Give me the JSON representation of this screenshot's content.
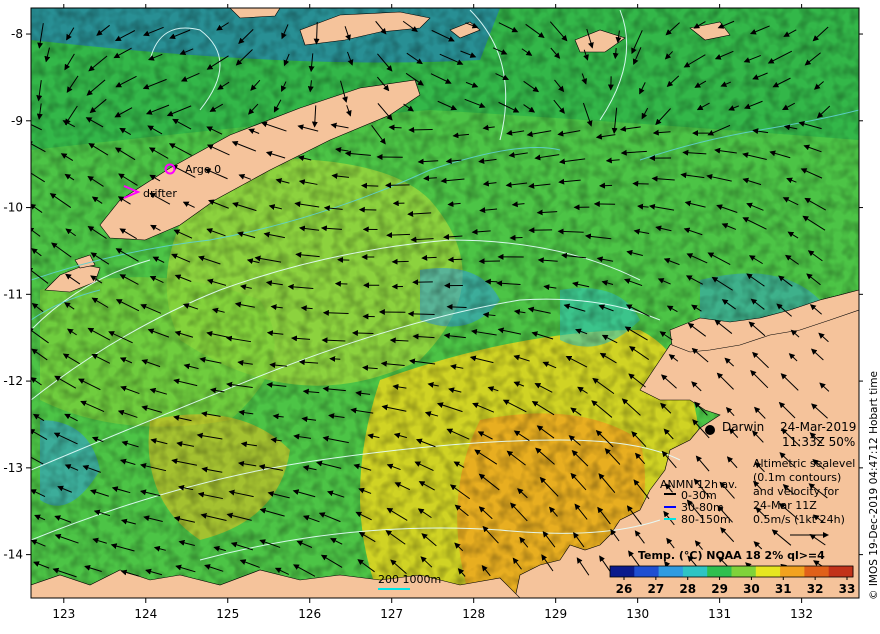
{
  "map": {
    "lon_ticks": [
      "123",
      "124",
      "125",
      "126",
      "127",
      "128",
      "129",
      "130",
      "131",
      "132"
    ],
    "lat_ticks": [
      "-8",
      "-9",
      "-10",
      "-11",
      "-12",
      "-13",
      "-14"
    ],
    "lon_range": [
      122.6,
      132.7
    ],
    "lat_range": [
      -7.7,
      -14.5
    ]
  },
  "labels": {
    "argo": "Argo 0",
    "drifter": "drifter",
    "city": "Darwin",
    "date": "24-Mar-2019",
    "time_cover": "11:33Z  50%",
    "credit": "© IMOS 19-Dec-2019 04:47:12 Hobart time",
    "scale_bar": "200  1000m"
  },
  "legend_sealevel": {
    "lines": [
      "Altimetric sealevel",
      "(0.1m contours)",
      "and velocity for",
      "24-Mar 11Z",
      "0.5m/s (1kt 24h)"
    ]
  },
  "legend_anmn": {
    "title": "ANMN 12h av.",
    "items": [
      {
        "label": "0-30m",
        "color": "#000000"
      },
      {
        "label": "30-80m",
        "color": "#0000ff"
      },
      {
        "label": "80-150m",
        "color": "#00e5e5"
      }
    ]
  },
  "colorbar": {
    "title": "Temp. (°C) NOAA 18 2% ql>=4",
    "ticks": [
      "26",
      "27",
      "28",
      "29",
      "30",
      "31",
      "32",
      "33"
    ],
    "colors": [
      "#0a1a8c",
      "#1f4fd1",
      "#2f9be0",
      "#2ec4c4",
      "#2fbf4f",
      "#7fd23a",
      "#e6e61f",
      "#f2a21f",
      "#e0601a",
      "#c2321a"
    ]
  },
  "colors": {
    "land": "#f5c39b",
    "sea_base": "#4cc446",
    "marker_argo": "#ff00ff"
  }
}
